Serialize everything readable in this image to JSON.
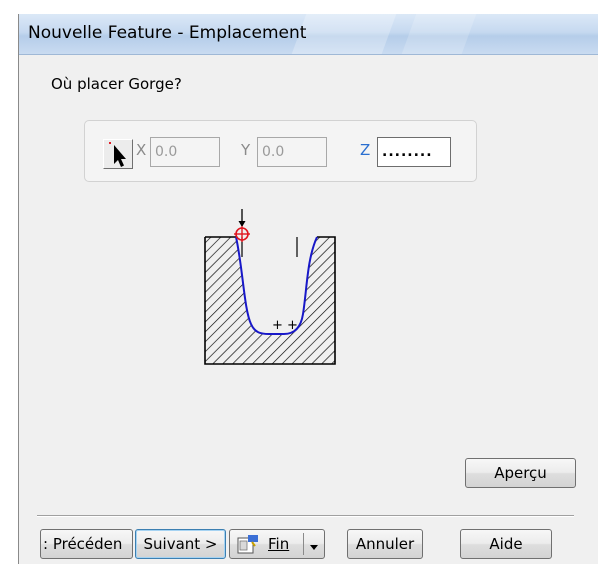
{
  "window": {
    "title": "Nouvelle Feature - Emplacement"
  },
  "prompt": "Où placer Gorge?",
  "coordinates": {
    "x_label": "X",
    "x_value": "0.0",
    "y_label": "Y",
    "y_value": "0.0",
    "z_label": "Z",
    "z_value": "........",
    "pick_icon": "pick-point-cursor-icon"
  },
  "diagram": {
    "icon": "groove-placement-diagram",
    "marker_icon": "target-point-icon"
  },
  "buttons": {
    "apercu": "Aperçu",
    "precedent": ": Précéden",
    "suivant": "Suivant >",
    "fin": "Fin",
    "annuler": "Annuler",
    "aide": "Aide"
  },
  "colors": {
    "accent": "#2a6fd0",
    "marker": "#e0141e",
    "profile": "#1818c8"
  }
}
